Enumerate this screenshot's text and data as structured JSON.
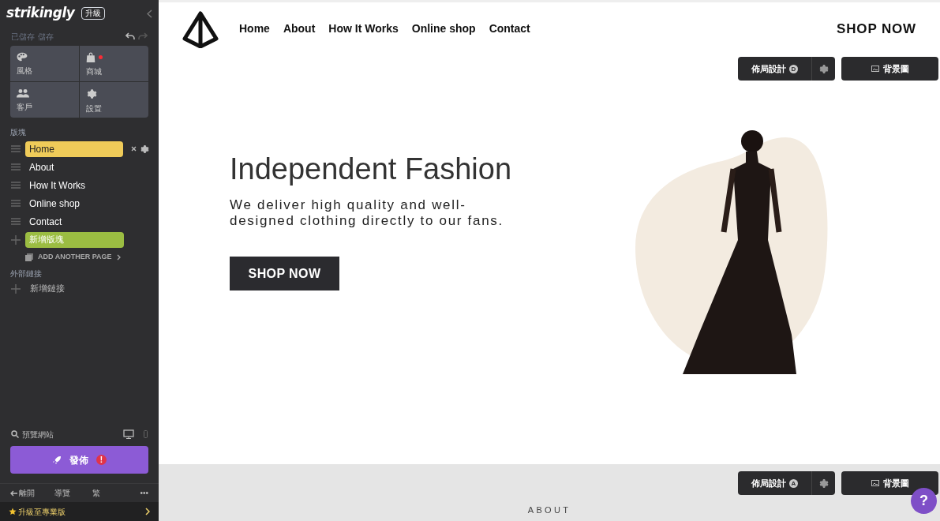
{
  "sidebar": {
    "brand": "strikingly",
    "upgrade_badge": "升級",
    "save_status": "已儲存",
    "save_link": "儲存",
    "tiles": [
      {
        "label": "風格",
        "kind": "palette",
        "dot": false
      },
      {
        "label": "商城",
        "kind": "bag",
        "dot": true
      },
      {
        "label": "客戶",
        "kind": "people",
        "dot": false
      },
      {
        "label": "設置",
        "kind": "gear",
        "dot": false
      }
    ],
    "sections_heading": "版塊",
    "sections": [
      {
        "label": "Home",
        "selected": true
      },
      {
        "label": "About",
        "selected": false
      },
      {
        "label": "How It Works",
        "selected": false
      },
      {
        "label": "Online shop",
        "selected": false
      },
      {
        "label": "Contact",
        "selected": false
      }
    ],
    "add_section": "新增版塊",
    "add_page": "ADD ANOTHER PAGE",
    "links_heading": "外部鏈接",
    "add_link": "新增鏈接",
    "preview": "預覽網站",
    "publish": "發佈",
    "publish_alert": "!",
    "footer": [
      "離開",
      "導覽",
      "繁",
      "•••"
    ],
    "upgrade_pro": "升級至專業版"
  },
  "site": {
    "nav": [
      "Home",
      "About",
      "How It Works",
      "Online shop",
      "Contact"
    ],
    "nav_cta": "SHOP NOW",
    "hero": {
      "layout_button": "佈局設計",
      "layout_letter": "D",
      "background_button": "背景圖",
      "title": "Independent Fashion",
      "subtitle": "We deliver high quality and well-designed clothing directly to our fans.",
      "cta": "SHOP NOW"
    },
    "next_section": {
      "layout_button": "佈局設計",
      "layout_letter": "A",
      "background_button": "背景圖",
      "heading": "ABOUT"
    },
    "help": "?"
  }
}
